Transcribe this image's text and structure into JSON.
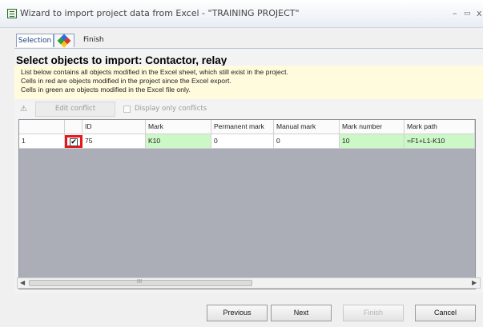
{
  "window": {
    "title": "Wizard to import project data from Excel - \"TRAINING PROJECT\"",
    "min_glyph": "–",
    "max_glyph": "▭",
    "close_glyph": "x"
  },
  "tabs": {
    "selection": "Selection",
    "finish": "Finish"
  },
  "heading": "Select objects to import: Contactor, relay",
  "info": [
    "List below contains all objects modified in the Excel sheet, which still exist in the project.",
    "Cells in red are objects modified in the project since the Excel export.",
    "Cells in green are objects modified in the Excel file only."
  ],
  "toolbar": {
    "edit_conflict": "Edit conflict",
    "display_only_conflicts": "Display only conflicts"
  },
  "grid": {
    "columns": [
      "",
      "",
      "ID",
      "Mark",
      "Permanent mark",
      "Manual mark",
      "Mark number",
      "Mark path"
    ],
    "rows": [
      {
        "index": "1",
        "checked": true,
        "check_glyph": "✔",
        "id": "75",
        "mark": "K10",
        "permanent_mark": "0",
        "manual_mark": "0",
        "mark_number": "10",
        "mark_path": "=F1+L1-K10"
      }
    ]
  },
  "scrollbar": {
    "left_arrow": "◀",
    "right_arrow": "▶",
    "grip": "III"
  },
  "buttons": {
    "previous": "Previous",
    "next": "Next",
    "finish": "Finish",
    "cancel": "Cancel"
  },
  "colors": {
    "modified_excel": "#ccf7c7",
    "highlight_box": "#e5191c",
    "info_bg": "#fffbdc",
    "grid_empty": "#abaeb6"
  }
}
